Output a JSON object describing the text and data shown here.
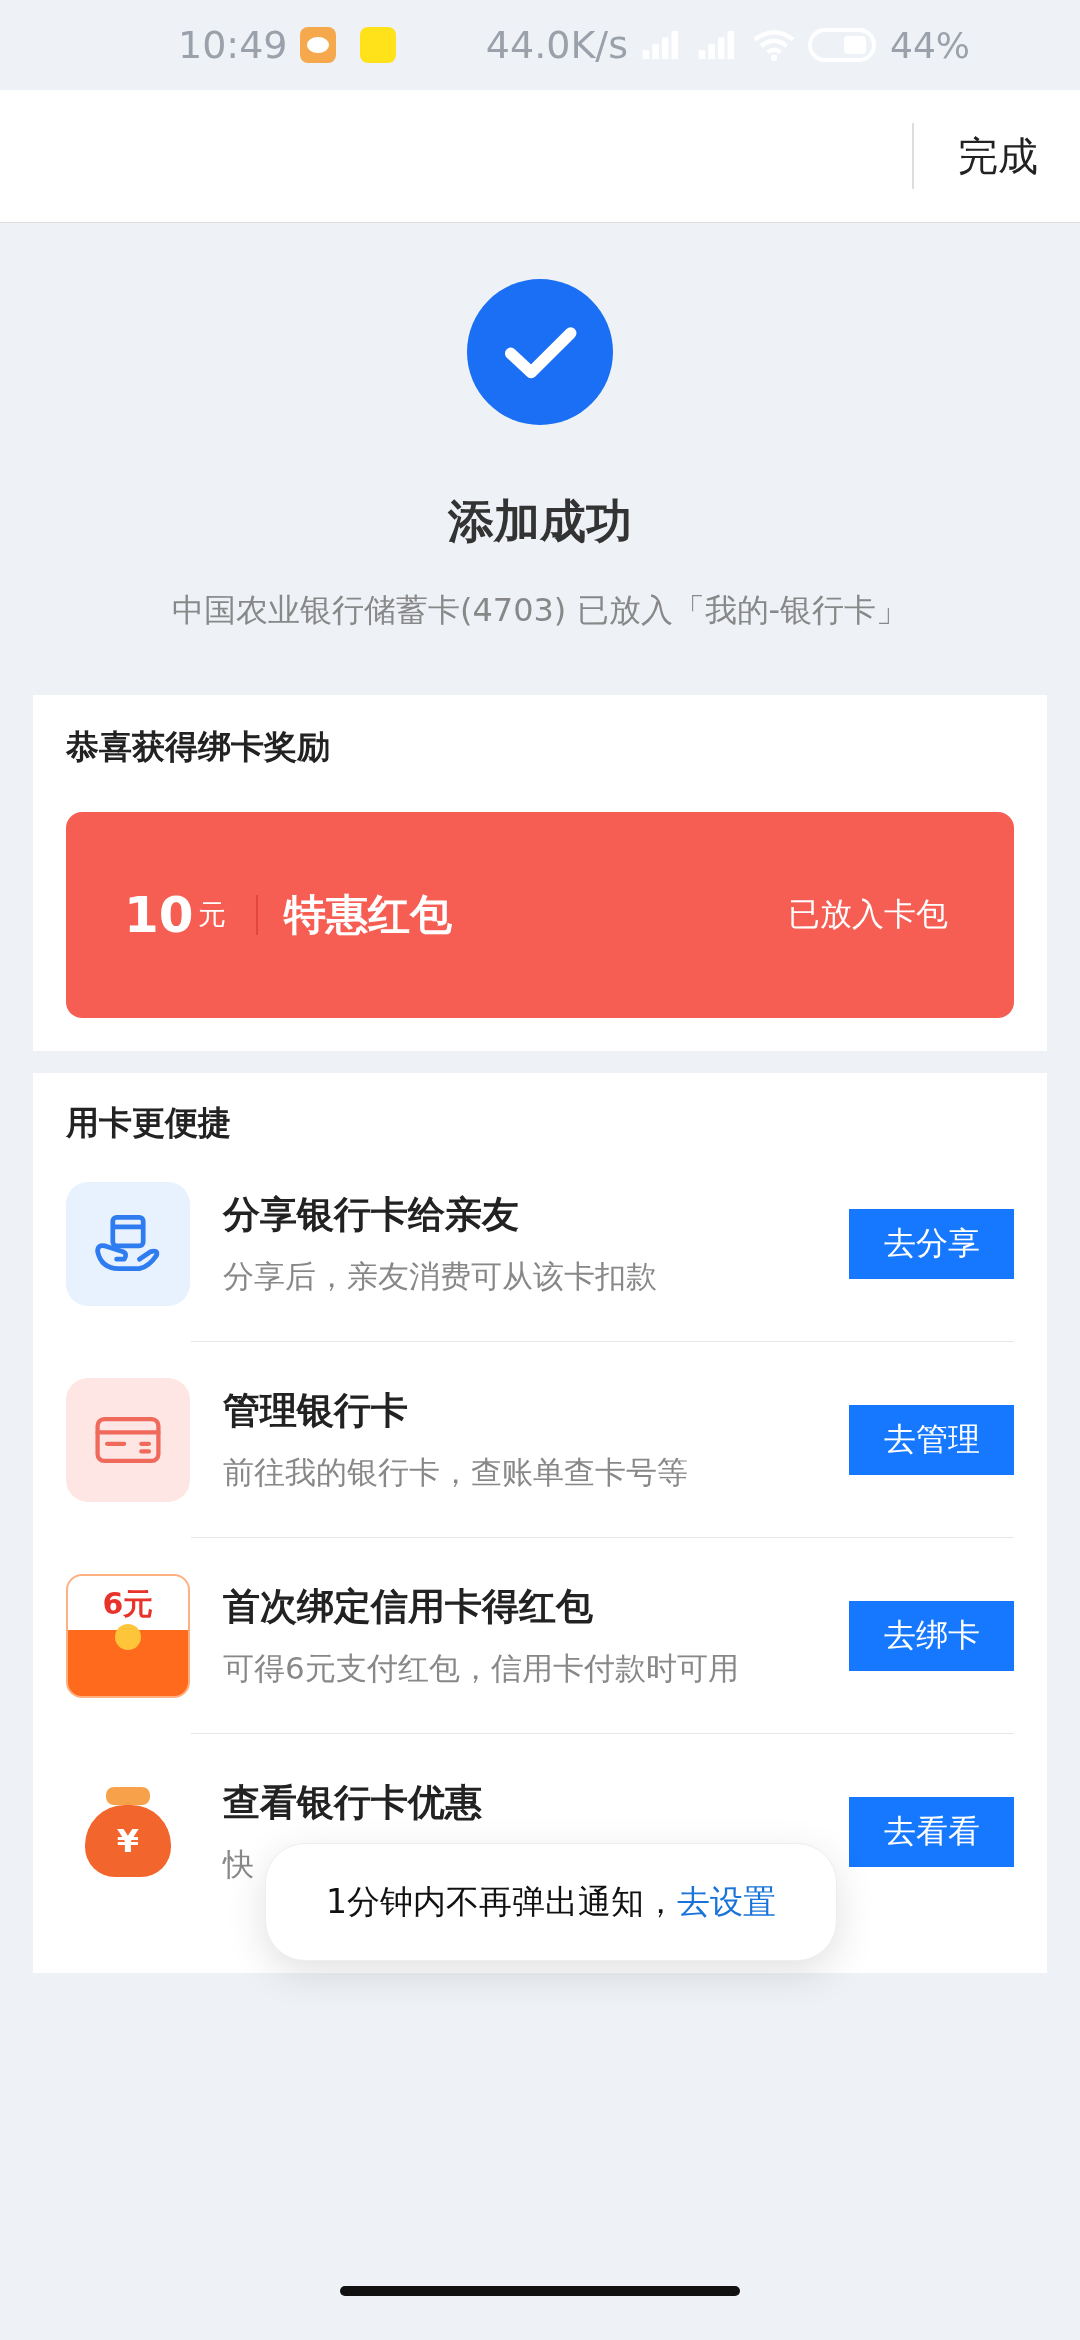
{
  "status_bar": {
    "time": "10:49",
    "network_speed": "44.0K/s",
    "battery": "44%"
  },
  "header": {
    "done_button": "完成"
  },
  "result": {
    "title": "添加成功",
    "message": "中国农业银行储蓄卡(4703) 已放入「我的-银行卡」"
  },
  "reward": {
    "title": "恭喜获得绑卡奖励",
    "amount": "10",
    "unit": "元",
    "name": "特惠红包",
    "status": "已放入卡包"
  },
  "features": {
    "title": "用卡更便捷",
    "items": [
      {
        "kind": "share",
        "title": "分享银行卡给亲友",
        "subtitle": "分享后，亲友消费可从该卡扣款",
        "button": "去分享"
      },
      {
        "kind": "card",
        "title": "管理银行卡",
        "subtitle": "前往我的银行卡，查账单查卡号等",
        "button": "去管理"
      },
      {
        "kind": "envelope",
        "icon_text": "6元",
        "title": "首次绑定信用卡得红包",
        "subtitle": "可得6元支付红包，信用卡付款时可用",
        "button": "去绑卡"
      },
      {
        "kind": "bag",
        "icon_text": "¥",
        "title": "查看银行卡优惠",
        "subtitle": "快",
        "button": "去看看"
      }
    ]
  },
  "toast": {
    "message": "1分钟内不再弹出通知，",
    "link": "去设置"
  }
}
